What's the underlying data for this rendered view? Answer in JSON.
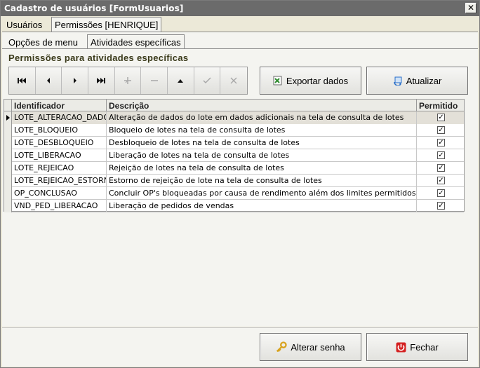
{
  "window": {
    "title": "Cadastro de usuários [FormUsuarios]",
    "close_glyph": "✕"
  },
  "tabs": [
    {
      "label": "Usuários",
      "active": false
    },
    {
      "label": "Permissões [HENRIQUE]",
      "active": true
    }
  ],
  "subtabs": [
    {
      "label": "Opções de menu",
      "active": false
    },
    {
      "label": "Atividades específicas",
      "active": true
    }
  ],
  "section_title": "Permissões para atividades específicas",
  "navigator": {
    "buttons": [
      {
        "name": "first",
        "glyph": "⏮",
        "enabled": true
      },
      {
        "name": "prior",
        "glyph": "◀",
        "enabled": true
      },
      {
        "name": "next",
        "glyph": "▶",
        "enabled": true
      },
      {
        "name": "last",
        "glyph": "⏭",
        "enabled": true
      },
      {
        "name": "insert",
        "glyph": "+",
        "enabled": false
      },
      {
        "name": "delete",
        "glyph": "−",
        "enabled": false
      },
      {
        "name": "edit",
        "glyph": "▲",
        "enabled": true
      },
      {
        "name": "post",
        "glyph": "✔",
        "enabled": false
      },
      {
        "name": "cancel",
        "glyph": "✕",
        "enabled": false
      }
    ]
  },
  "buttons": {
    "export": "Exportar dados",
    "refresh": "Atualizar",
    "change_password": "Alterar senha",
    "close": "Fechar"
  },
  "grid": {
    "columns": [
      "Identificador",
      "Descrição",
      "Permitido"
    ],
    "rows": [
      {
        "id": "LOTE_ALTERACAO_DADOS",
        "desc": "Alteração de dados do lote em dados adicionais na tela de consulta de lotes",
        "allowed": true
      },
      {
        "id": "LOTE_BLOQUEIO",
        "desc": "Bloqueio de lotes na tela de consulta de lotes",
        "allowed": true
      },
      {
        "id": "LOTE_DESBLOQUEIO",
        "desc": "Desbloqueio de lotes na tela de consulta de lotes",
        "allowed": true
      },
      {
        "id": "LOTE_LIBERACAO",
        "desc": "Liberação de lotes na tela de consulta de lotes",
        "allowed": true
      },
      {
        "id": "LOTE_REJEICAO",
        "desc": "Rejeição de lotes na tela de consulta de lotes",
        "allowed": true
      },
      {
        "id": "LOTE_REJEICAO_ESTORNO",
        "desc": "Estorno de rejeição de lote na tela de consulta de lotes",
        "allowed": true
      },
      {
        "id": "OP_CONCLUSAO",
        "desc": "Concluir OP's bloqueadas por causa de rendimento além dos limites permitidos",
        "allowed": true
      },
      {
        "id": "VND_PED_LIBERACAO",
        "desc": "Liberação de pedidos de vendas",
        "allowed": true
      }
    ],
    "selected_row": 0
  },
  "colors": {
    "titlebar": "#6b6b6b",
    "form_bg": "#f4f4f0",
    "section_title": "#3a3a1a",
    "close_icon_red": "#d42020",
    "export_icon_green": "#2e8b2e",
    "refresh_icon_blue": "#2a6fc9",
    "key_icon_gold": "#d8a21c"
  }
}
